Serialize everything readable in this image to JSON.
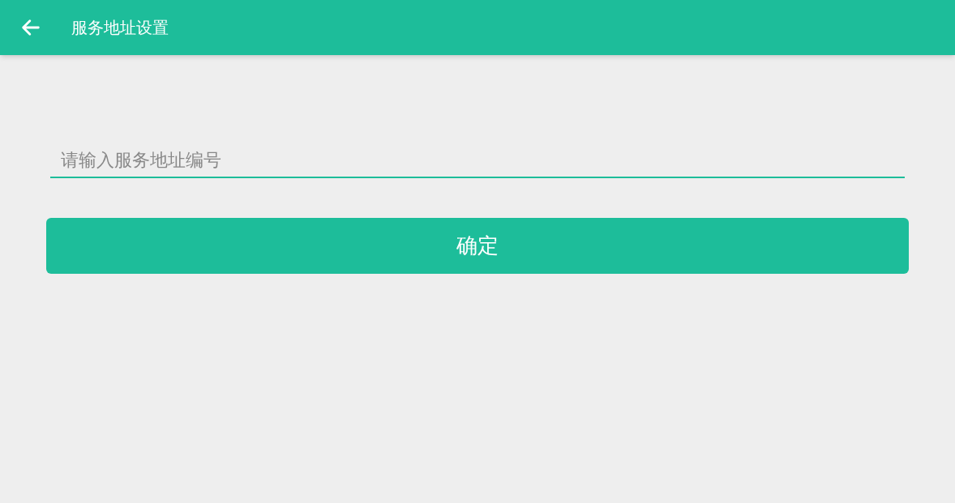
{
  "app_bar": {
    "title": "服务地址设置"
  },
  "address_field": {
    "placeholder": "请输入服务地址编号"
  },
  "confirm_button": {
    "label": "确定"
  }
}
